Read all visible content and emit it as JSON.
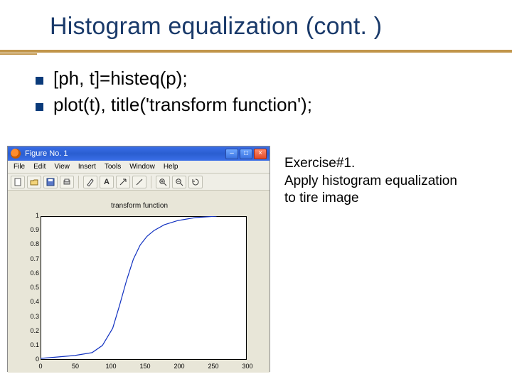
{
  "title": "Histogram equalization (cont. )",
  "bullets": [
    "[ph, t]=histeq(p);",
    "plot(t), title('transform function');"
  ],
  "exercise": {
    "line1": "Exercise#1.",
    "line2": "Apply histogram equalization",
    "line3": "to tire image"
  },
  "figure": {
    "window_title": "Figure No. 1",
    "menu": [
      "File",
      "Edit",
      "View",
      "Insert",
      "Tools",
      "Window",
      "Help"
    ],
    "plot_title": "transform function",
    "y_ticks": [
      "1",
      "0.9",
      "0.8",
      "0.7",
      "0.6",
      "0.5",
      "0.4",
      "0.3",
      "0.2",
      "0.1",
      "0"
    ],
    "x_ticks": [
      "0",
      "50",
      "100",
      "150",
      "200",
      "250",
      "300"
    ]
  },
  "chart_data": {
    "type": "line",
    "title": "transform function",
    "xlabel": "",
    "ylabel": "",
    "xlim": [
      0,
      300
    ],
    "ylim": [
      0,
      1
    ],
    "x": [
      0,
      25,
      50,
      75,
      90,
      105,
      115,
      125,
      135,
      145,
      155,
      165,
      180,
      200,
      225,
      256
    ],
    "y": [
      0.01,
      0.02,
      0.03,
      0.05,
      0.1,
      0.22,
      0.38,
      0.55,
      0.7,
      0.8,
      0.86,
      0.9,
      0.94,
      0.97,
      0.99,
      1.0
    ]
  }
}
